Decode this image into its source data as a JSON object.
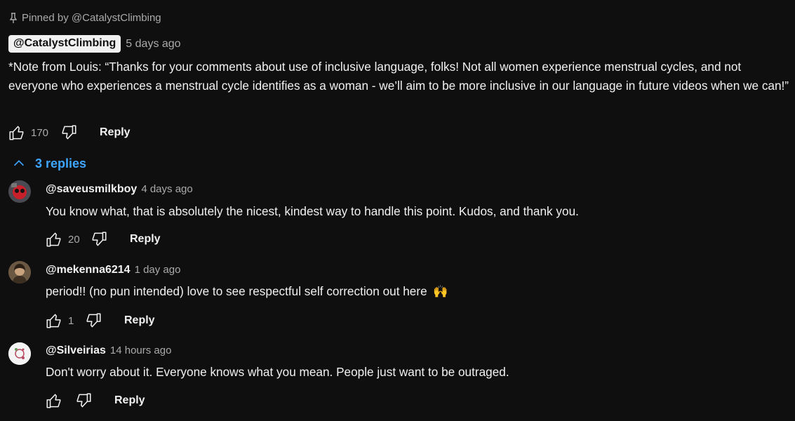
{
  "pinned": {
    "label": "Pinned by @CatalystClimbing",
    "icon": "pin-icon"
  },
  "comment": {
    "author": "@CatalystClimbing",
    "time": "5 days ago",
    "text": "*Note from Louis: “Thanks for your comments about use of inclusive language, folks! Not all women experience menstrual cycles, and not everyone who experiences a menstrual cycle identifies as a woman - we’ll aim to be more inclusive in our language in future videos when we can!”",
    "likes": "170",
    "reply_label": "Reply"
  },
  "replies_toggle": {
    "label": "3 replies",
    "icon": "chevron-up-icon"
  },
  "replies": [
    {
      "author": "@saveusmilkboy",
      "time": "4 days ago",
      "text": "You know what, that is absolutely the nicest, kindest way to handle this point. Kudos, and thank you.",
      "likes": "20",
      "reply_label": "Reply"
    },
    {
      "author": "@mekenna6214",
      "time": "1 day ago",
      "text": "period!! (no pun intended) love to see respectful self correction out here",
      "emoji": "🙌",
      "likes": "1",
      "reply_label": "Reply"
    },
    {
      "author": "@Silveirias",
      "time": "14 hours ago",
      "text": "Don't worry about it. Everyone knows what you mean. People just want to be outraged.",
      "likes": "",
      "reply_label": "Reply"
    }
  ],
  "colors": {
    "background": "#0f0f0f",
    "link": "#3ea6ff",
    "secondary": "#aaaaaa"
  }
}
